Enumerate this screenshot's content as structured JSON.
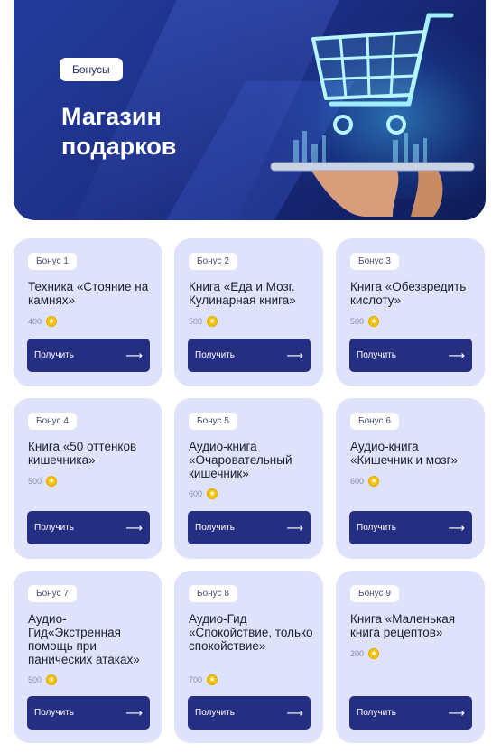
{
  "hero": {
    "badge": "Бонусы",
    "title": "Магазин подарков"
  },
  "cards": [
    {
      "tag": "Бонус 1",
      "title": "Техника «Стояние на камнях»",
      "price": "400",
      "button": "Получить"
    },
    {
      "tag": "Бонус 2",
      "title": "Книга «Еда и Мозг. Кулинарная книга»",
      "price": "500",
      "button": "Получить"
    },
    {
      "tag": "Бонус 3",
      "title": "Книга «Обезвредить кислоту»",
      "price": "500",
      "button": "Получить"
    },
    {
      "tag": "Бонус 4",
      "title": "Книга «50 оттенков кишечника»",
      "price": "500",
      "button": "Получить"
    },
    {
      "tag": "Бонус 5",
      "title": "Аудио-книга «Очаровательный кишечник»",
      "price": "600",
      "button": "Получить"
    },
    {
      "tag": "Бонус 6",
      "title": "Аудио-книга «Кишечник и мозг»",
      "price": "600",
      "button": "Получить"
    },
    {
      "tag": "Бонус 7",
      "title": "Аудио-Гид«Экстренная помощь при панических атаках»",
      "price": "500",
      "button": "Получить"
    },
    {
      "tag": "Бонус 8",
      "title": "Аудио-Гид «Спокойствие, только спокойствие»",
      "price": "700",
      "button": "Получить"
    },
    {
      "tag": "Бонус 9",
      "title": "Книга «Маленькая книга рецептов»",
      "price": "200",
      "button": "Получить"
    }
  ],
  "icons": {
    "coin": "coin-icon",
    "arrow": "arrow-right-icon",
    "hero_image": "shopping-cart-icon"
  },
  "colors": {
    "accent": "#252f82",
    "card_bg": "#dfe2fb",
    "coin": "#f5c400"
  }
}
